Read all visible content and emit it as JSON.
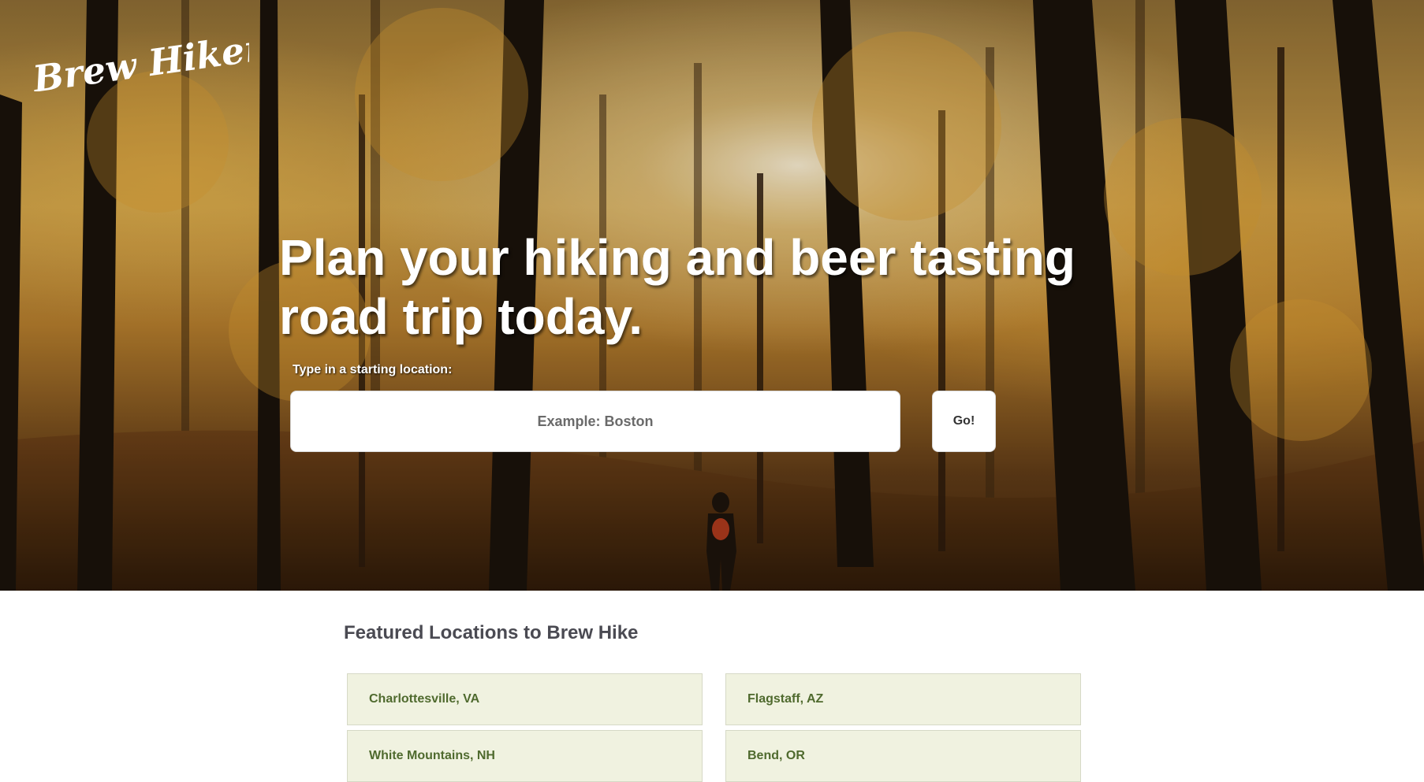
{
  "brand": {
    "logo_text": "Brew Hikers"
  },
  "hero": {
    "headline": "Plan your hiking and beer tasting road trip today.",
    "prompt_label": "Type in a starting location:",
    "search_placeholder": "Example: Boston",
    "go_label": "Go!"
  },
  "featured": {
    "title": "Featured Locations to Brew Hike",
    "locations": [
      {
        "label": "Charlottesville, VA"
      },
      {
        "label": "Flagstaff, AZ"
      },
      {
        "label": "White Mountains, NH"
      },
      {
        "label": "Bend, OR"
      }
    ]
  },
  "colors": {
    "card_background": "#f0f2e0",
    "card_text": "#4f6a2e",
    "heading_text": "#4a4a52"
  }
}
